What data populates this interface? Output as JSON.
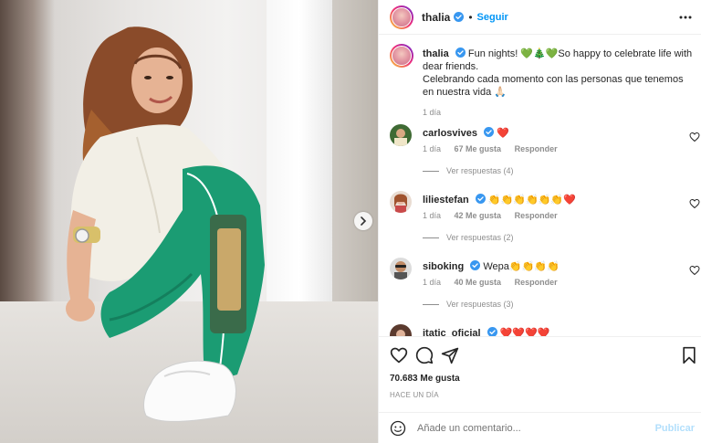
{
  "post": {
    "username": "thalia",
    "separator": "•",
    "follow_label": "Seguir",
    "caption_user": "thalia",
    "caption_line1": "Fun nights! 💚🎄💚So happy to celebrate life with dear friends.",
    "caption_line2": "Celebrando cada momento con las personas que tenemos en nuestra vida 🙏🏻",
    "caption_time": "1 día",
    "likes": "70.683 Me gusta",
    "time_ago": "HACE UN DÍA"
  },
  "comments": [
    {
      "user": "carlosvives",
      "text": "❤️",
      "time": "1 día",
      "likes": "67 Me gusta",
      "reply": "Responder",
      "replies": "Ver respuestas (4)"
    },
    {
      "user": "liliestefan",
      "text": "👏👏👏👏👏👏❤️",
      "time": "1 día",
      "likes": "42 Me gusta",
      "reply": "Responder",
      "replies": "Ver respuestas (2)"
    },
    {
      "user": "siboking",
      "text": "Wepa👏👏👏👏",
      "time": "1 día",
      "likes": "40 Me gusta",
      "reply": "Responder",
      "replies": "Ver respuestas (3)"
    },
    {
      "user": "itatic_oficial",
      "text": "❤️❤️❤️❤️"
    }
  ],
  "composer": {
    "placeholder": "Añade un comentario...",
    "publish_label": "Publicar"
  },
  "icons": {
    "verified": "verified-badge-icon",
    "more": "more-options-icon",
    "like": "heart-icon",
    "comment": "comment-icon",
    "share": "paper-plane-icon",
    "save": "bookmark-icon",
    "emoji": "smiley-icon",
    "next": "chevron-right-icon"
  },
  "colors": {
    "link_blue": "#0095f6",
    "verified_blue": "#3897f0",
    "publish_disabled": "#b2dffc",
    "secondary_text": "#8e8e8e"
  }
}
